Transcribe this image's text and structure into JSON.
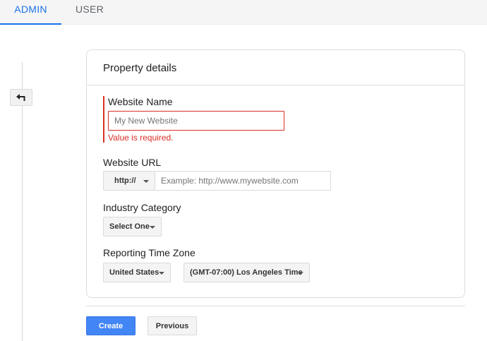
{
  "tabs": [
    {
      "label": "ADMIN",
      "active": true
    },
    {
      "label": "USER",
      "active": false
    }
  ],
  "back_button": {
    "icon": "back-arrow-icon"
  },
  "card": {
    "title": "Property details",
    "website_name": {
      "label": "Website Name",
      "placeholder": "My New Website",
      "value": "",
      "error": "Value is required."
    },
    "website_url": {
      "label": "Website URL",
      "protocol": "http://",
      "placeholder": "Example: http://www.mywebsite.com",
      "value": ""
    },
    "industry_category": {
      "label": "Industry Category",
      "selected": "Select One"
    },
    "reporting_time_zone": {
      "label": "Reporting Time Zone",
      "country": "United States",
      "zone": "(GMT-07:00) Los Angeles Time"
    }
  },
  "actions": {
    "create_label": "Create",
    "previous_label": "Previous"
  },
  "colors": {
    "accent": "#1a73e8",
    "error": "#d93025",
    "primary_button": "#4285f4"
  }
}
